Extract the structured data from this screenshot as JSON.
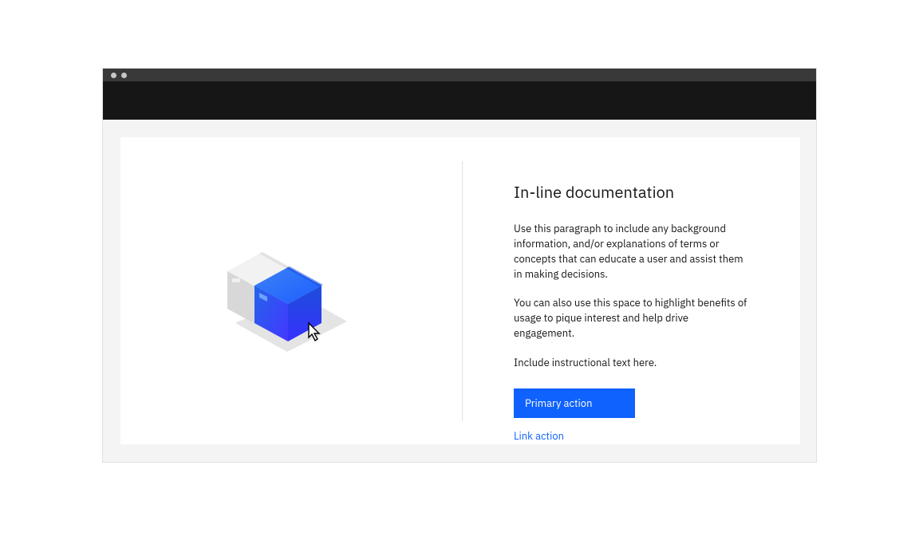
{
  "heading": "In-line documentation",
  "paragraph1": "Use this paragraph to include any background information,  and/or explanations of terms or concepts that can educate a user and assist them in making decisions.",
  "paragraph2": "You can also use this space to highlight benefits of usage to pique interest and help drive engagement.",
  "paragraph3": "Include instructional text here.",
  "primary_button_label": "Primary action",
  "link_action_label": "Link action"
}
